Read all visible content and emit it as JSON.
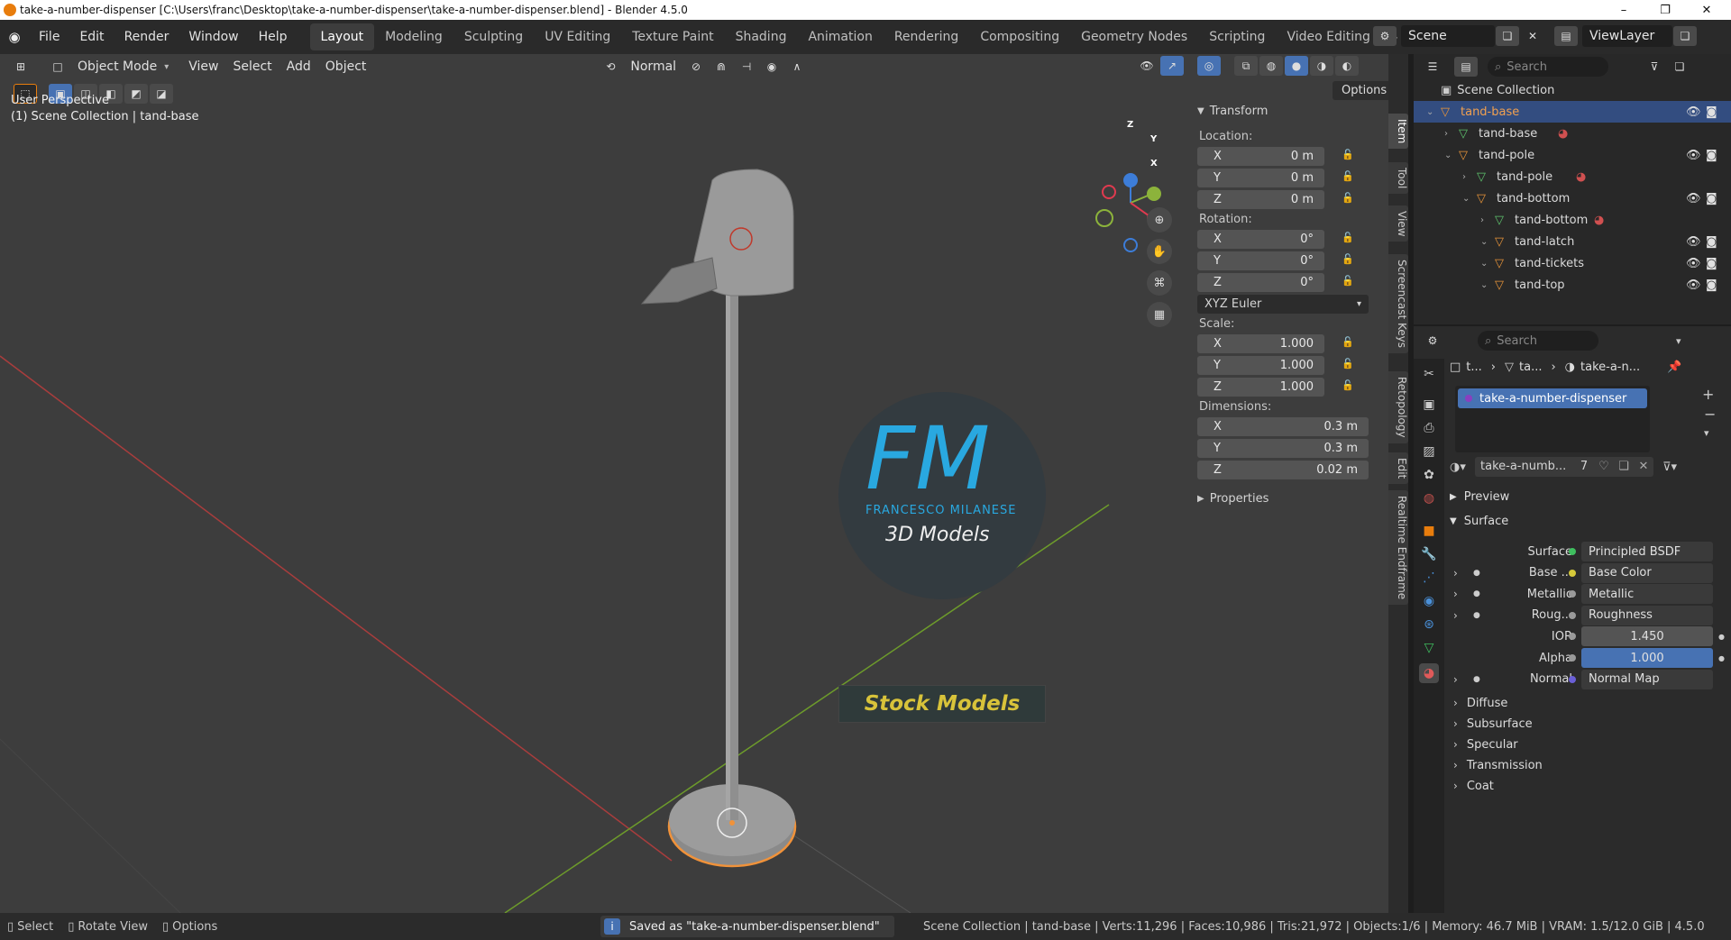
{
  "window": {
    "title": "take-a-number-dispenser [C:\\Users\\franc\\Desktop\\take-a-number-dispenser\\take-a-number-dispenser.blend] - Blender 4.5.0",
    "controls": [
      "–",
      "❐",
      "✕"
    ]
  },
  "menu": [
    "File",
    "Edit",
    "Render",
    "Window",
    "Help"
  ],
  "workspaces": [
    "Layout",
    "Modeling",
    "Sculpting",
    "UV Editing",
    "Texture Paint",
    "Shading",
    "Animation",
    "Rendering",
    "Compositing",
    "Geometry Nodes",
    "Scripting",
    "Video Editing"
  ],
  "active_workspace": "Layout",
  "scene": {
    "label": "Scene",
    "viewlayer": "ViewLayer"
  },
  "viewport": {
    "mode": "Object Mode",
    "menus": [
      "View",
      "Select",
      "Add",
      "Object"
    ],
    "orientation": "Normal",
    "options_label": "Options",
    "perspective_label": "User Perspective",
    "collection_label": "(1) Scene Collection | tand-base",
    "axes": {
      "x": "X",
      "y": "Y",
      "z": "Z"
    }
  },
  "transform": {
    "header": "Transform",
    "location_label": "Location:",
    "location": [
      {
        "axis": "X",
        "value": "0 m"
      },
      {
        "axis": "Y",
        "value": "0 m"
      },
      {
        "axis": "Z",
        "value": "0 m"
      }
    ],
    "rotation_label": "Rotation:",
    "rotation": [
      {
        "axis": "X",
        "value": "0°"
      },
      {
        "axis": "Y",
        "value": "0°"
      },
      {
        "axis": "Z",
        "value": "0°"
      }
    ],
    "rotation_mode": "XYZ Euler",
    "scale_label": "Scale:",
    "scale": [
      {
        "axis": "X",
        "value": "1.000"
      },
      {
        "axis": "Y",
        "value": "1.000"
      },
      {
        "axis": "Z",
        "value": "1.000"
      }
    ],
    "dimensions_label": "Dimensions:",
    "dimensions": [
      {
        "axis": "X",
        "value": "0.3 m"
      },
      {
        "axis": "Y",
        "value": "0.3 m"
      },
      {
        "axis": "Z",
        "value": "0.02 m"
      }
    ],
    "properties_label": "Properties"
  },
  "side_tabs": [
    "Item",
    "Tool",
    "View",
    "Screencast Keys",
    "Retopology",
    "Edit",
    "Realtime Endframe"
  ],
  "watermark": {
    "logo": "FM",
    "name": "FRANCESCO MILANESE",
    "sub": "3D Models",
    "banner": "Stock Models"
  },
  "outliner": {
    "search_placeholder": "Search",
    "root": "Scene Collection",
    "items": [
      {
        "label": "tand-base",
        "depth": 0,
        "type": "object",
        "selected": true,
        "vis": true
      },
      {
        "label": "tand-base",
        "depth": 1,
        "type": "mesh",
        "selected": false,
        "vis": false
      },
      {
        "label": "tand-pole",
        "depth": 1,
        "type": "object",
        "selected": false,
        "vis": true
      },
      {
        "label": "tand-pole",
        "depth": 2,
        "type": "mesh",
        "selected": false,
        "vis": false
      },
      {
        "label": "tand-bottom",
        "depth": 2,
        "type": "object",
        "selected": false,
        "vis": true
      },
      {
        "label": "tand-bottom",
        "depth": 3,
        "type": "mesh",
        "selected": false,
        "vis": false
      },
      {
        "label": "tand-latch",
        "depth": 3,
        "type": "object",
        "selected": false,
        "vis": true
      },
      {
        "label": "tand-tickets",
        "depth": 3,
        "type": "object",
        "selected": false,
        "vis": true
      },
      {
        "label": "tand-top",
        "depth": 3,
        "type": "object",
        "selected": false,
        "vis": true
      }
    ]
  },
  "properties": {
    "search_placeholder": "Search",
    "breadcrumb": [
      "t...",
      "ta...",
      "take-a-n..."
    ],
    "material_slot": "take-a-number-dispenser",
    "material_name": "take-a-numb...",
    "user_count": "7",
    "preview_label": "Preview",
    "surface_label": "Surface",
    "rows": [
      {
        "label": "Surface",
        "value": "Principled BSDF",
        "color": "#3fbf5f",
        "expand": false,
        "kind": "slot"
      },
      {
        "label": "Base ...",
        "value": "Base Color",
        "color": "#d6c93a",
        "expand": true,
        "kind": "slot"
      },
      {
        "label": "Metallic",
        "value": "Metallic",
        "color": "#9a9a9a",
        "expand": true,
        "kind": "slot"
      },
      {
        "label": "Roug...",
        "value": "Roughness",
        "color": "#9a9a9a",
        "expand": true,
        "kind": "slot"
      },
      {
        "label": "IOR",
        "value": "1.450",
        "color": "#9a9a9a",
        "expand": false,
        "kind": "num"
      },
      {
        "label": "Alpha",
        "value": "1.000",
        "color": "#9a9a9a",
        "expand": false,
        "kind": "numfill"
      },
      {
        "label": "Normal",
        "value": "Normal Map",
        "color": "#6a5fd6",
        "expand": true,
        "kind": "slot"
      }
    ],
    "sections": [
      "Diffuse",
      "Subsurface",
      "Specular",
      "Transmission",
      "Coat"
    ]
  },
  "status": {
    "hints": [
      "Select",
      "Rotate View",
      "Options"
    ],
    "message": "Saved as \"take-a-number-dispenser.blend\"",
    "info": "Scene Collection | tand-base | Verts:11,296 | Faces:10,986 | Tris:21,972 | Objects:1/6 | Memory: 46.7 MiB | VRAM: 1.5/12.0 GiB | 4.5.0"
  }
}
